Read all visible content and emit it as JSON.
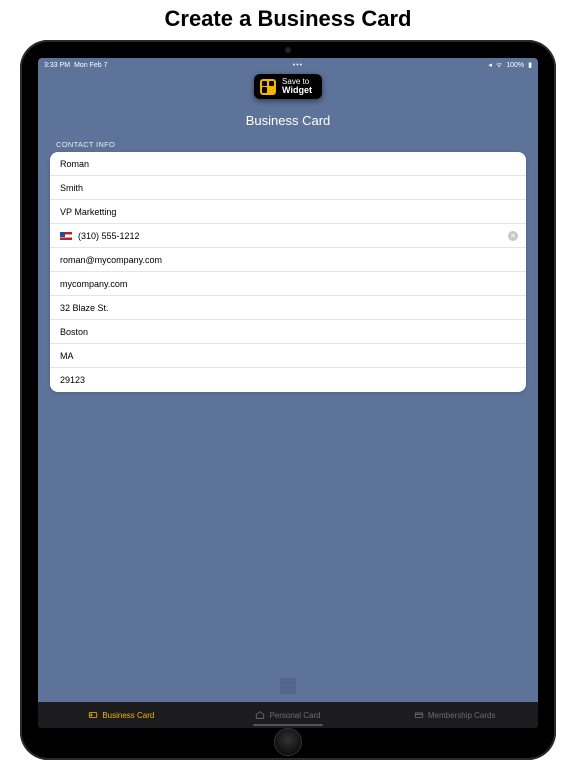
{
  "page_heading": "Create a Business Card",
  "status": {
    "time": "3:33 PM",
    "date": "Mon Feb 7",
    "battery": "100%"
  },
  "widget_button": {
    "line1": "Save to",
    "line2": "Widget"
  },
  "screen_title": "Business Card",
  "section_label": "CONTACT INFO",
  "contact": {
    "first_name": "Roman",
    "last_name": "Smith",
    "title": "VP Marketting",
    "phone": "(310) 555-1212",
    "email": "roman@mycompany.com",
    "website": "mycompany.com",
    "street": "32 Blaze St.",
    "city": "Boston",
    "state": "MA",
    "zip": "29123"
  },
  "tabs": {
    "business": "Business Card",
    "personal": "Personal Card",
    "membership": "Membership Cards"
  }
}
